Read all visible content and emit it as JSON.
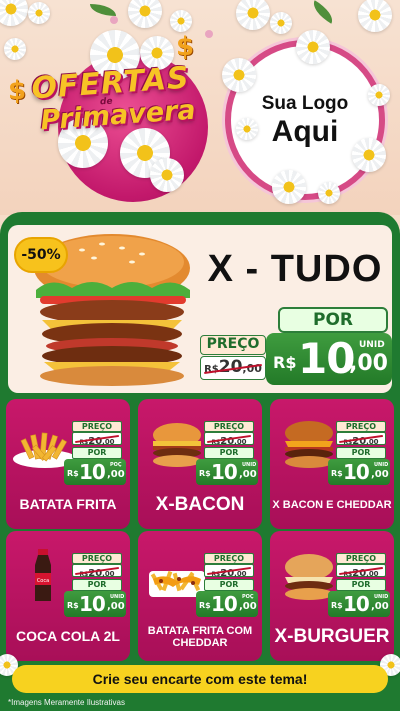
{
  "header": {
    "promo_title": "OFERTAS",
    "promo_connector": "de",
    "promo_subtitle": "Primavera",
    "currency_symbol": "$",
    "logo_line1": "Sua Logo",
    "logo_line2": "Aqui"
  },
  "featured": {
    "discount": "-50%",
    "name": "X - TUDO",
    "preco_label": "PREÇO",
    "old_price": {
      "currency": "R$",
      "int": "20",
      "dec": ",00"
    },
    "por_label": "POR",
    "price": {
      "currency": "R$",
      "int": "10",
      "dec": ",00",
      "unit": "UNID"
    }
  },
  "products": [
    {
      "name": "BATATA FRITA",
      "preco_label": "PREÇO",
      "old_int": "20",
      "old_dec": ",00",
      "old_currency": "R$",
      "por_label": "POR",
      "currency": "R$",
      "int": "10",
      "dec": ",00",
      "unit": "POÇ"
    },
    {
      "name": "X-BACON",
      "preco_label": "PREÇO",
      "old_int": "20",
      "old_dec": ",00",
      "old_currency": "R$",
      "por_label": "POR",
      "currency": "R$",
      "int": "10",
      "dec": ",00",
      "unit": "UNID"
    },
    {
      "name": "X BACON E CHEDDAR",
      "preco_label": "PREÇO",
      "old_int": "20",
      "old_dec": ",00",
      "old_currency": "R$",
      "por_label": "POR",
      "currency": "R$",
      "int": "10",
      "dec": ",00",
      "unit": "UNID"
    },
    {
      "name": "COCA COLA 2L",
      "preco_label": "PREÇO",
      "old_int": "20",
      "old_dec": ",00",
      "old_currency": "R$",
      "por_label": "POR",
      "currency": "R$",
      "int": "10",
      "dec": ",00",
      "unit": "UNID"
    },
    {
      "name": "BATATA FRITA COM CHEDDAR",
      "preco_label": "PREÇO",
      "old_int": "20",
      "old_dec": ",00",
      "old_currency": "R$",
      "por_label": "POR",
      "currency": "R$",
      "int": "10",
      "dec": ",00",
      "unit": "POÇ"
    },
    {
      "name": "X-BURGUER",
      "preco_label": "PREÇO",
      "old_int": "20",
      "old_dec": ",00",
      "old_currency": "R$",
      "por_label": "POR",
      "currency": "R$",
      "int": "10",
      "dec": ",00",
      "unit": "UNID"
    }
  ],
  "footer": {
    "cta": "Crie seu encarte com este tema!",
    "disclaimer": "*Imagens Meramente Ilustrativas"
  },
  "colors": {
    "accent_pink": "#c8186a",
    "accent_green": "#237a28",
    "accent_yellow": "#f7d21f",
    "background": "#f6dcc8"
  },
  "icons": [
    "daisy-flower-icon",
    "burger-image",
    "fries-image",
    "coke-bottle-image",
    "cheddar-fries-image"
  ]
}
